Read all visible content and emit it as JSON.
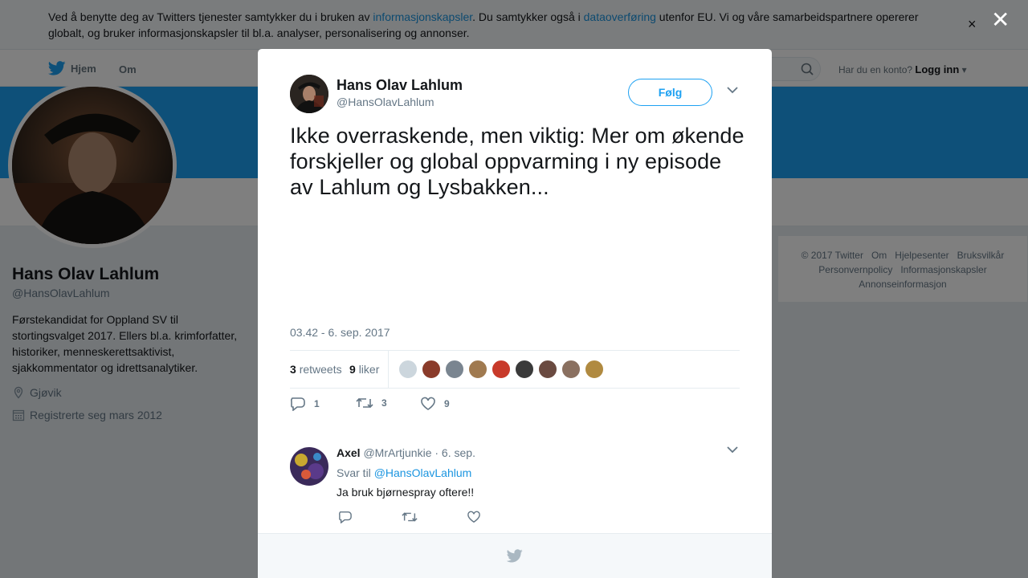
{
  "cookie": {
    "text_before": "Ved å benytte deg av Twitters tjenester samtykker du i bruken av ",
    "link1": "informasjonskapsler",
    "text_middle": ". Du samtykker også i ",
    "link2": "dataoverføring",
    "text_after": " utenfor EU. Vi og våre samarbeidspartnere opererer globalt, og bruker informasjonskapsler til bl.a. analyser, personalisering og annonser.",
    "close": "×"
  },
  "nav": {
    "home": "Hjem",
    "about": "Om",
    "login_prompt": "Har du en konto?",
    "login": "Logg inn"
  },
  "profile": {
    "name": "Hans Olav Lahlum",
    "handle": "@HansOlavLahlum",
    "bio": "Førstekandidat for Oppland SV til stortingsvalget 2017. Ellers bl.a. krimforfatter, historiker, menneskerettsaktivist, sjakkommentator og idrettsanalytiker.",
    "location": "Gjøvik",
    "joined": "Registrerte seg mars 2012"
  },
  "footer_links": [
    "© 2017 Twitter",
    "Om",
    "Hjelpesenter",
    "Bruksvilkår",
    "Personvernpolicy",
    "Informasjonskapsler",
    "Annonseinformasjon"
  ],
  "modal_close": "✕",
  "tweet": {
    "name": "Hans Olav Lahlum",
    "handle": "@HansOlavLahlum",
    "follow": "Følg",
    "text": "Ikke overraskende, men viktig: Mer om økende forskjeller og global oppvarming i ny episode av Lahlum og Lysbakken...",
    "timestamp": "03.42 - 6. sep. 2017",
    "retweets_count": "3",
    "retweets_label": "retweets",
    "likes_count": "9",
    "likes_label": "liker",
    "reply_count": "1",
    "retweet_count": "3",
    "like_count": "9",
    "liker_colors": [
      "#ccd6dd",
      "#8a3b2a",
      "#7a8590",
      "#a07a50",
      "#c83a2a",
      "#3a3a3a",
      "#6a4a40",
      "#8a7060",
      "#b08a40"
    ]
  },
  "reply": {
    "name": "Axel",
    "handle": "@MrArtjunkie",
    "date": "· 6. sep.",
    "reply_to_label": "Svar til",
    "reply_to_handle": "@HansOlavLahlum",
    "text": "Ja bruk bjørnespray oftere!!"
  },
  "colors": {
    "accent": "#1da1f2",
    "link": "#1b95e0",
    "muted": "#657786"
  }
}
